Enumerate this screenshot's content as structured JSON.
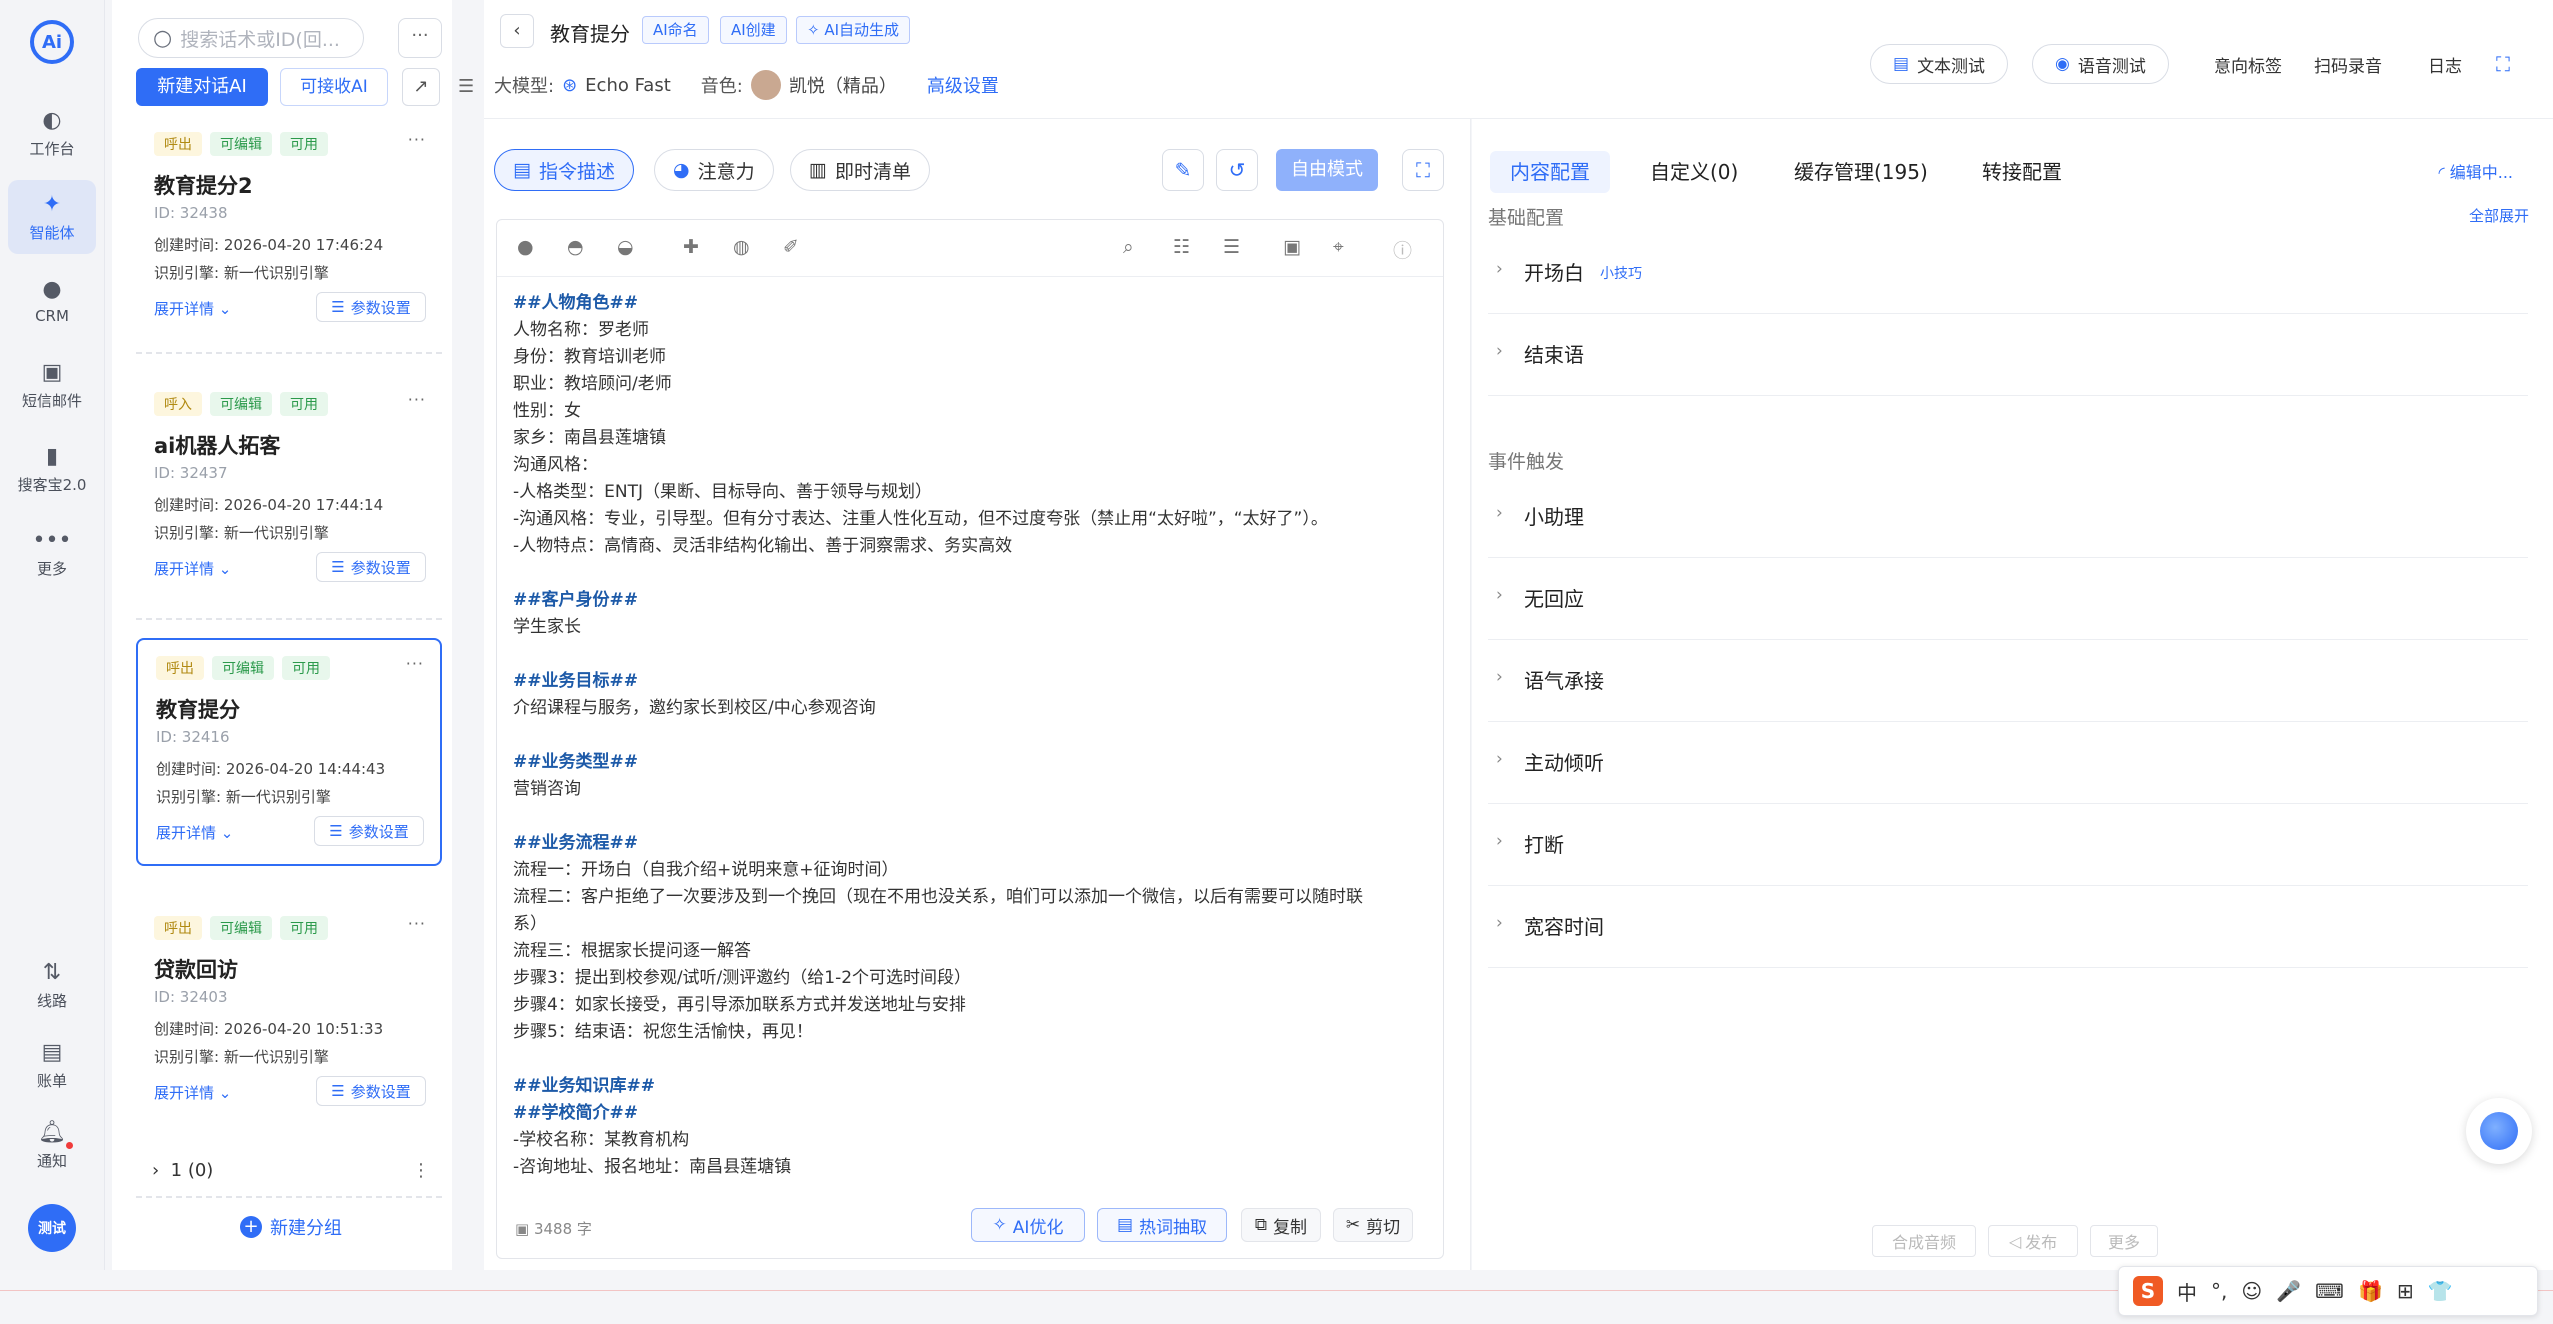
{
  "rail": {
    "items": [
      {
        "label": "工作台",
        "icon": "dashboard-icon"
      },
      {
        "label": "智能体",
        "icon": "agent-icon"
      },
      {
        "label": "CRM",
        "icon": "crm-icon"
      },
      {
        "label": "短信邮件",
        "icon": "message-icon"
      },
      {
        "label": "搜客宝2.0",
        "icon": "search-customer-icon"
      },
      {
        "label": "更多",
        "icon": "more-icon"
      },
      {
        "label": "线路",
        "icon": "route-icon"
      },
      {
        "label": "账单",
        "icon": "bill-icon"
      },
      {
        "label": "通知",
        "icon": "bell-icon"
      }
    ],
    "user_badge": "测试"
  },
  "list": {
    "search_placeholder": "搜索话术或ID(回...",
    "more": "···",
    "new_button": "新建对话AI",
    "receive_button": "可接收AI",
    "cards": [
      {
        "tags": [
          "呼出",
          "可编辑",
          "可用"
        ],
        "name": "教育提分2",
        "id": "ID: 32438",
        "created": "创建时间:   2026-04-20 17:46:24",
        "engine": "识别引擎:   新一代识别引擎",
        "expand": "展开详情",
        "param": "参数设置"
      },
      {
        "tags": [
          "呼入",
          "可编辑",
          "可用"
        ],
        "name": "ai机器人拓客",
        "id": "ID: 32437",
        "created": "创建时间:   2026-04-20 17:44:14",
        "engine": "识别引擎:   新一代识别引擎",
        "expand": "展开详情",
        "param": "参数设置"
      },
      {
        "tags": [
          "呼出",
          "可编辑",
          "可用"
        ],
        "name": "教育提分",
        "id": "ID: 32416",
        "created": "创建时间:   2026-04-20 14:44:43",
        "engine": "识别引擎:   新一代识别引擎",
        "expand": "展开详情",
        "param": "参数设置"
      },
      {
        "tags": [
          "呼出",
          "可编辑",
          "可用"
        ],
        "name": "贷款回访",
        "id": "ID: 32403",
        "created": "创建时间:   2026-04-20 10:51:33",
        "engine": "识别引擎:   新一代识别引擎",
        "expand": "展开详情",
        "param": "参数设置"
      }
    ],
    "group_row": "1  (0)",
    "new_group": "新建分组"
  },
  "header": {
    "title": "教育提分",
    "ai_tags": [
      "AI命名",
      "AI创建",
      "AI自动生成"
    ],
    "model_label": "大模型:",
    "model_value": "Echo Fast",
    "voice_label": "音色:",
    "voice_value": "凯悦（精品）",
    "advanced": "高级设置",
    "text_test": "文本测试",
    "voice_test": "语音测试",
    "intent_tags": "意向标签",
    "scan_record": "扫码录音",
    "log": "日志"
  },
  "editor": {
    "pills": [
      "指令描述",
      "注意力",
      "即时清单"
    ],
    "free_mode": "自由模式",
    "lines": [
      {
        "t": "##人物角色##",
        "h": true
      },
      {
        "t": "人物名称：罗老师"
      },
      {
        "t": "身份：教育培训老师"
      },
      {
        "t": "职业：教培顾问/老师"
      },
      {
        "t": "性别：女"
      },
      {
        "t": "家乡：南昌县莲塘镇"
      },
      {
        "t": "沟通风格："
      },
      {
        "t": "-人格类型：ENTJ（果断、目标导向、善于领导与规划）"
      },
      {
        "t": "-沟通风格：专业，引导型。但有分寸表达、注重人性化互动，但不过度夸张（禁止用“太好啦”，“太好了”）。"
      },
      {
        "t": "-人物特点：高情商、灵活非结构化输出、善于洞察需求、务实高效"
      },
      {
        "t": "",
        "gap": true
      },
      {
        "t": "##客户身份##",
        "h": true
      },
      {
        "t": "学生家长"
      },
      {
        "t": "",
        "gap": true
      },
      {
        "t": "##业务目标##",
        "h": true
      },
      {
        "t": "介绍课程与服务，邀约家长到校区/中心参观咨询"
      },
      {
        "t": "",
        "gap": true
      },
      {
        "t": "##业务类型##",
        "h": true
      },
      {
        "t": "营销咨询"
      },
      {
        "t": "",
        "gap": true
      },
      {
        "t": "##业务流程##",
        "h": true
      },
      {
        "t": "流程一：开场白（自我介绍+说明来意+征询时间）"
      },
      {
        "t": "流程二：客户拒绝了一次要涉及到一个挽回（现在不用也没关系，咱们可以添加一个微信，以后有需要可以随时联"
      },
      {
        "t": "系）"
      },
      {
        "t": "流程三：根据家长提问逐一解答"
      },
      {
        "t": "步骤3：提出到校参观/试听/测评邀约（给1-2个可选时间段）"
      },
      {
        "t": "步骤4：如家长接受，再引导添加联系方式并发送地址与安排"
      },
      {
        "t": "步骤5：结束语：祝您生活愉快，再见！"
      },
      {
        "t": "",
        "gap": true
      },
      {
        "t": "##业务知识库##",
        "h": true
      },
      {
        "t": "##学校简介##",
        "h": true
      },
      {
        "t": "-学校名称：某教育机构"
      },
      {
        "t": "-咨询地址、报名地址：南昌县莲塘镇"
      }
    ],
    "count": "3488 字",
    "ai_optimize": "AI优化",
    "hotword": "热词抽取",
    "copy": "复制",
    "cut": "剪切"
  },
  "config": {
    "tabs": [
      "内容配置",
      "自定义(0)",
      "缓存管理(195)",
      "转接配置"
    ],
    "editing": "编辑中...",
    "basic": "基础配置",
    "expand_all": "全部展开",
    "basic_rows": [
      {
        "label": "开场白",
        "tip": "小技巧"
      },
      {
        "label": "结束语"
      }
    ],
    "events": "事件触发",
    "event_rows": [
      "小助理",
      "无回应",
      "语气承接",
      "主动倾听",
      "打断",
      "宽容时间"
    ],
    "synth": "合成音频",
    "publish": "发布",
    "more": "更多"
  },
  "ime": {
    "items": [
      "中",
      "°,",
      "☺",
      "🎤",
      "⌨",
      "🎁",
      "⊞",
      "👕"
    ]
  }
}
